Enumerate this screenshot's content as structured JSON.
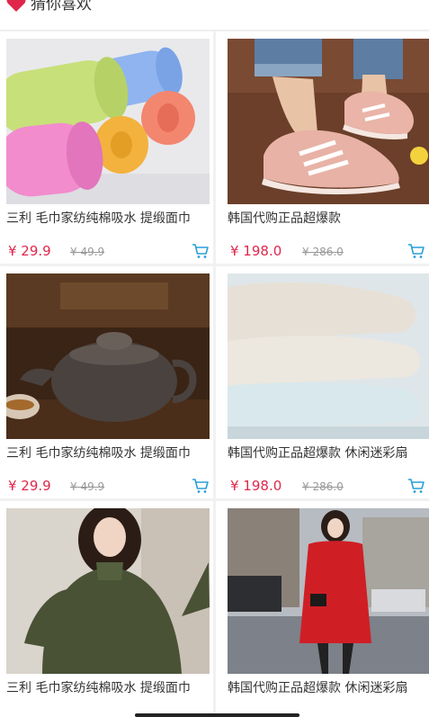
{
  "header": {
    "title": "猜你喜欢",
    "icon": "heart-icon",
    "accent": "#e0264b"
  },
  "products": [
    {
      "title": "三利 毛巾家纺纯棉吸水 提缎面巾",
      "price": "¥ 29.9",
      "old_price": "¥ 49.9",
      "image": "towel-rolls-image"
    },
    {
      "title": "韩国代购正品超爆款",
      "price": "¥ 198.0",
      "old_price": "¥ 286.0",
      "image": "pink-sneakers-image"
    },
    {
      "title": "三利 毛巾家纺纯棉吸水 提缎面巾",
      "price": "¥ 29.9",
      "old_price": "¥ 49.9",
      "image": "teapot-image"
    },
    {
      "title": "韩国代购正品超爆款 休闲迷彩扇",
      "price": "¥ 198.0",
      "old_price": "¥ 286.0",
      "image": "white-towels-image"
    },
    {
      "title": "三利 毛巾家纺纯棉吸水 提缎面巾",
      "image": "green-sweater-image"
    },
    {
      "title": "韩国代购正品超爆款 休闲迷彩扇",
      "image": "red-coat-image"
    }
  ],
  "colors": {
    "price": "#e0264b",
    "old_price": "#999999",
    "cart": "#2a9fd8"
  }
}
